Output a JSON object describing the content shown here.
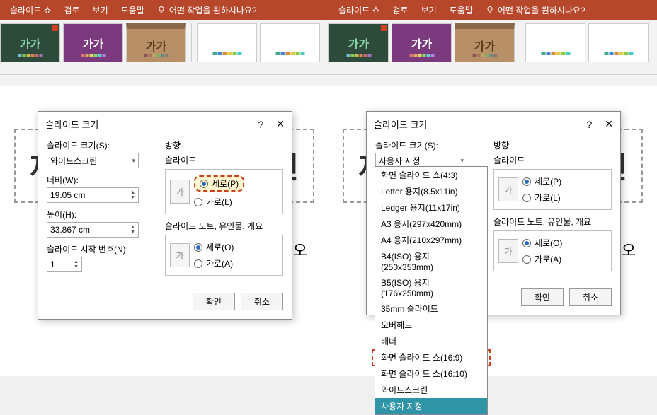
{
  "ribbon": {
    "tabs": [
      "슬라이드 쇼",
      "검토",
      "보기",
      "도움말"
    ],
    "tell_me": "어떤 작업을 원하시나요?"
  },
  "theme_text": "가가",
  "dialog": {
    "title": "슬라이드 크기",
    "help": "?",
    "close": "✕",
    "size_label": "슬라이드 크기(S):",
    "width_label": "너비(W):",
    "height_label": "높이(H):",
    "start_num_label": "슬라이드 시작 번호(N):",
    "width_value": "19.05 cm",
    "height_value": "33.867 cm",
    "start_num_value": "1",
    "direction_title": "방향",
    "slide_title": "슬라이드",
    "notes_title": "슬라이드 노트, 유인물, 개요",
    "portrait": "세로(P)",
    "landscape": "가로(L)",
    "portrait_o": "세로(O)",
    "landscape_a": "가로(A)",
    "ok": "확인",
    "cancel": "취소",
    "icon_text": "가"
  },
  "left": {
    "size_value": "와이드스크린"
  },
  "right": {
    "size_value": "사용자 지정",
    "options": [
      "화면 슬라이드 쇼(4:3)",
      "Letter 용지(8.5x11in)",
      "Ledger 용지(11x17in)",
      "A3 용지(297x420mm)",
      "A4 용지(210x297mm)",
      "B4(ISO) 용지(250x353mm)",
      "B5(ISO) 용지(176x250mm)",
      "35mm 슬라이드",
      "오버헤드",
      "배너",
      "화면 슬라이드 쇼(16:9)",
      "화면 슬라이드 쇼(16:10)",
      "와이드스크린",
      "사용자 지정"
    ]
  },
  "bg_title_left": "제",
  "bg_title_right": "면",
  "bg_corner": "오"
}
